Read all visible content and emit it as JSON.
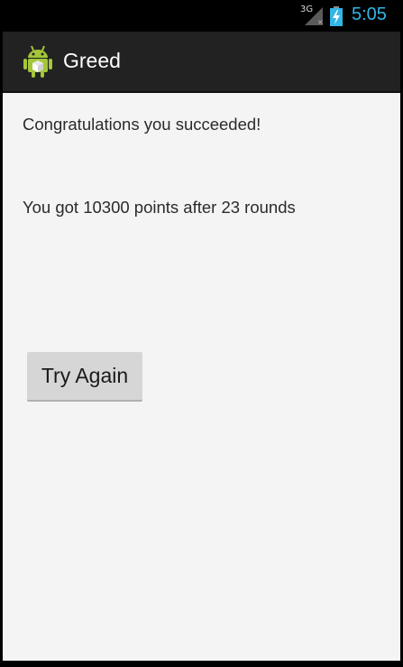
{
  "status_bar": {
    "network": "3G",
    "time": "5:05",
    "clock_color": "#33b5e5"
  },
  "action_bar": {
    "title": "Greed",
    "icon": "android-robot-icon"
  },
  "main": {
    "success_message": "Congratulations you succeeded!",
    "score_message": "You got 10300 points after 23 rounds",
    "try_again_label": "Try Again"
  }
}
